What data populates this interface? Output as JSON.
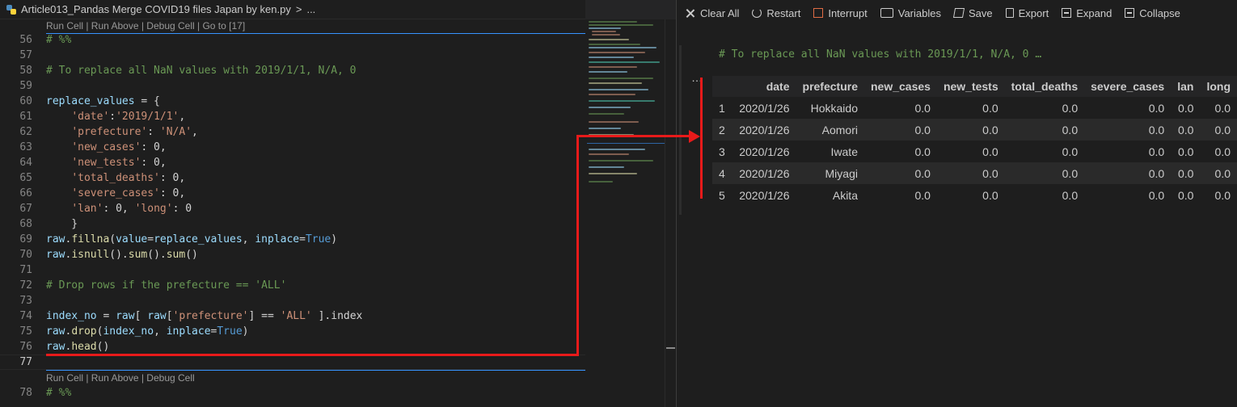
{
  "editor": {
    "tab_title": "Article013_Pandas Merge COVID19 files Japan by ken.py",
    "breadcrumb_chevron": ">",
    "breadcrumb_more": "...",
    "codelens_top": "Run Cell | Run Above | Debug Cell | Go to [17]",
    "codelens_bottom": "Run Cell | Run Above | Debug Cell",
    "line_numbers": [
      "56",
      "57",
      "58",
      "59",
      "60",
      "61",
      "62",
      "63",
      "64",
      "65",
      "66",
      "67",
      "68",
      "69",
      "70",
      "71",
      "72",
      "73",
      "74",
      "75",
      "76",
      "77",
      "78"
    ]
  },
  "interactive": {
    "toolbar": {
      "clear_all": "Clear All",
      "restart": "Restart",
      "interrupt": "Interrupt",
      "variables": "Variables",
      "save": "Save",
      "export": "Export",
      "expand": "Expand",
      "collapse": "Collapse"
    },
    "input_cell_code": "# To replace all NaN values with 2019/1/1, N/A, 0 …",
    "output_dots": "…",
    "table": {
      "columns": [
        "",
        "date",
        "prefecture",
        "new_cases",
        "new_tests",
        "total_deaths",
        "severe_cases",
        "lan",
        "long"
      ],
      "rows": [
        [
          "1",
          "2020/1/26",
          "Hokkaido",
          "0.0",
          "0.0",
          "0.0",
          "0.0",
          "0.0",
          "0.0"
        ],
        [
          "2",
          "2020/1/26",
          "Aomori",
          "0.0",
          "0.0",
          "0.0",
          "0.0",
          "0.0",
          "0.0"
        ],
        [
          "3",
          "2020/1/26",
          "Iwate",
          "0.0",
          "0.0",
          "0.0",
          "0.0",
          "0.0",
          "0.0"
        ],
        [
          "4",
          "2020/1/26",
          "Miyagi",
          "0.0",
          "0.0",
          "0.0",
          "0.0",
          "0.0",
          "0.0"
        ],
        [
          "5",
          "2020/1/26",
          "Akita",
          "0.0",
          "0.0",
          "0.0",
          "0.0",
          "0.0",
          "0.0"
        ]
      ]
    }
  },
  "colors": {
    "annotation": "#e81a1a",
    "comment": "#6a9955",
    "string": "#ce9178",
    "keyword": "#569cd6",
    "cell_separator": "#3794ff"
  }
}
